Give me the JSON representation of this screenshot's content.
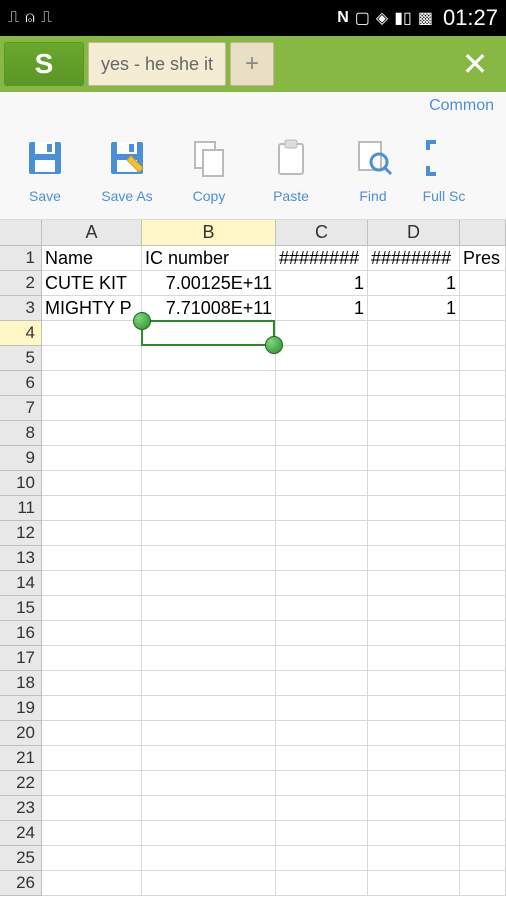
{
  "status": {
    "time": "01:27"
  },
  "titlebar": {
    "logo": "S",
    "tab_name": "yes - he she it",
    "new_tab": "+",
    "close": "✕"
  },
  "ribbon": {
    "group": "Common",
    "tools": [
      {
        "label": "Save"
      },
      {
        "label": "Save As"
      },
      {
        "label": "Copy"
      },
      {
        "label": "Paste"
      },
      {
        "label": "Find"
      },
      {
        "label": "Full Sc"
      }
    ]
  },
  "sheet": {
    "columns": [
      "A",
      "B",
      "C",
      "D",
      ""
    ],
    "rows": [
      "1",
      "2",
      "3",
      "4",
      "5",
      "6",
      "7",
      "8",
      "9",
      "10",
      "11",
      "12",
      "13",
      "14",
      "15",
      "16",
      "17",
      "18",
      "19",
      "20",
      "21",
      "22",
      "23",
      "24",
      "25",
      "26"
    ],
    "selected_row": 4,
    "selected_col": "B",
    "data": {
      "1": {
        "A": "Name",
        "B": "IC number",
        "C": "########",
        "D": "########",
        "E": "Pres"
      },
      "2": {
        "A": "CUTE KIT",
        "B": "7.00125E+11",
        "C": "1",
        "D": "1"
      },
      "3": {
        "A": "MIGHTY P",
        "B": "7.71008E+11",
        "C": "1",
        "D": "1"
      }
    }
  }
}
